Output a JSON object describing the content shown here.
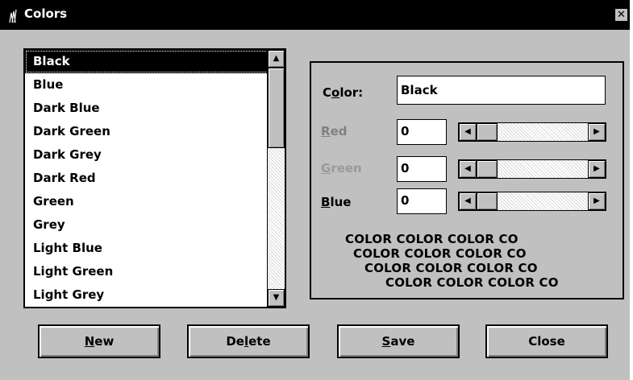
{
  "window": {
    "title": "Colors",
    "close_glyph": "✕"
  },
  "list": {
    "items": [
      "Black",
      "Blue",
      "Dark Blue",
      "Dark Green",
      "Dark Grey",
      "Dark Red",
      "Green",
      "Grey",
      "Light Blue",
      "Light Green",
      "Light Grey"
    ],
    "selected_index": 0
  },
  "color_panel": {
    "color_label_pre": "C",
    "color_label_u": "o",
    "color_label_post": "lor:",
    "color_value": "Black",
    "red_label_u": "R",
    "red_label_post": "ed",
    "red_value": "0",
    "green_label_u": "G",
    "green_label_post": "reen",
    "green_value": "0",
    "blue_label_u": "B",
    "blue_label_post": "lue",
    "blue_value": "0",
    "sample_lines": [
      "COLOR COLOR COLOR CO",
      "COLOR COLOR COLOR CO",
      "COLOR COLOR COLOR CO",
      "COLOR COLOR COLOR CO"
    ]
  },
  "buttons": {
    "new_u": "N",
    "new_post": "ew",
    "delete_pre": "De",
    "delete_u": "l",
    "delete_post": "ete",
    "save_u": "S",
    "save_post": "ave",
    "close": "Close"
  },
  "icons": {
    "scroll_up": "▲",
    "scroll_down": "▼",
    "scroll_left": "◀",
    "scroll_right": "▶"
  }
}
